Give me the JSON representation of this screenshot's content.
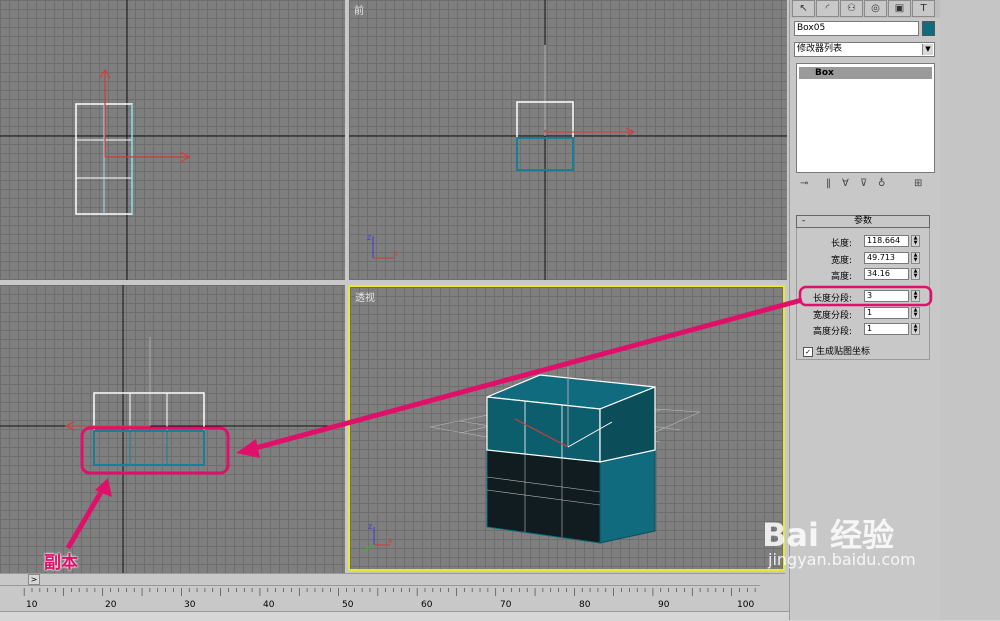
{
  "viewports": {
    "top_left_label": "",
    "top_right_label": "前",
    "bottom_left_label": "",
    "perspective_label": "透视"
  },
  "panel": {
    "tab_icons": [
      "select-arrow-icon",
      "modify-curve-icon",
      "hierarchy-icon",
      "motion-icon",
      "display-icon",
      "utilities-icon"
    ],
    "object_name": "Box05",
    "object_color": "#0f6b7d",
    "modifier_list": "修改器列表",
    "stack_item": "Box",
    "rollout_toggle": "-",
    "rollout_title": "参数",
    "params": {
      "length_label": "长度:",
      "length_value": "118.664",
      "width_label": "宽度:",
      "width_value": "49.713",
      "height_label": "高度:",
      "height_value": "34.16",
      "length_segs_label": "长度分段:",
      "length_segs_value": "3",
      "width_segs_label": "宽度分段:",
      "width_segs_value": "1",
      "height_segs_label": "高度分段:",
      "height_segs_value": "1"
    },
    "gen_mapping_label": "生成贴图坐标",
    "gen_mapping_checked": true
  },
  "timeline": {
    "ticks": [
      "10",
      "20",
      "30",
      "40",
      "50",
      "60",
      "70",
      "80",
      "90",
      "100"
    ]
  },
  "annotation": {
    "copy_label": "副本",
    "highlight_color": "#e0106a"
  },
  "watermark": {
    "logo": "Bai  经验",
    "url": "jingyan.baidu.com"
  },
  "colors": {
    "viewport_bg": "#7f7f7f",
    "active_viewport_border": "#e8e831",
    "box_color": "#0f6b7d"
  }
}
